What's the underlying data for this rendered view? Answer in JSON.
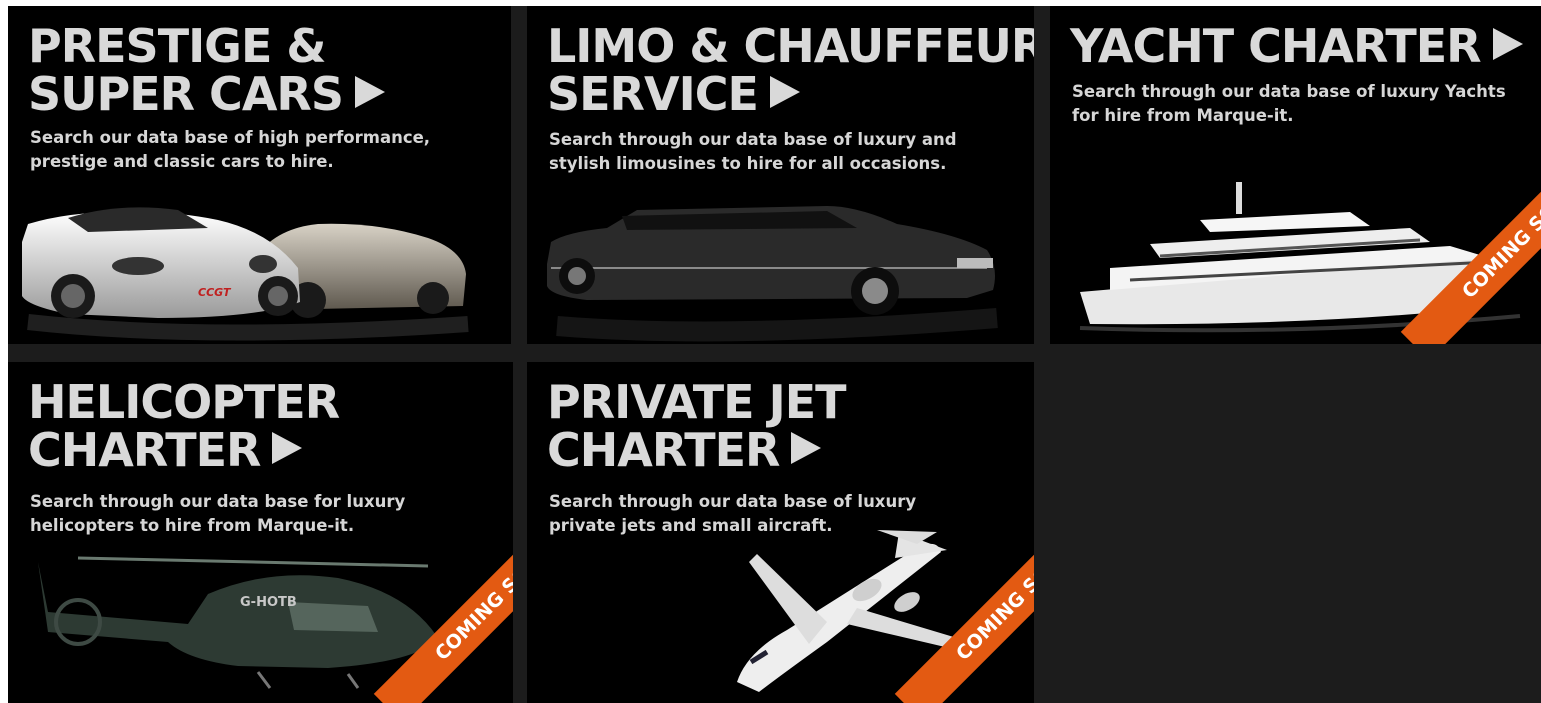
{
  "tiles": [
    {
      "heading": [
        "PRESTIGE &",
        "SUPER CARS"
      ],
      "description": [
        "Search our data base of high performance,",
        "prestige and classic cars to hire."
      ],
      "image": "sports-cars"
    },
    {
      "heading": [
        "LIMO & CHAUFFEUR",
        "SERVICE"
      ],
      "description": [
        "Search through our data base of luxury and",
        "stylish limousines to hire for all occasions."
      ],
      "image": "limousine"
    },
    {
      "heading": [
        "YACHT CHARTER"
      ],
      "description": [
        "Search through our data base of luxury Yachts",
        "for hire from Marque-it."
      ],
      "badge": "COMING SOON",
      "image": "yacht"
    },
    {
      "heading": [
        "HELICOPTER",
        "CHARTER"
      ],
      "description": [
        "Search through our data base for luxury",
        "helicopters to hire from Marque-it."
      ],
      "badge": "COMING SOON",
      "image": "helicopter",
      "registration": "G-HOTB"
    },
    {
      "heading": [
        "PRIVATE JET",
        "CHARTER"
      ],
      "description": [
        "Search through our data base of luxury",
        "private jets and small aircraft."
      ],
      "badge": "COMING SOON",
      "image": "private-jet"
    }
  ],
  "car_badge": "CCGT",
  "colors": {
    "tile_bg": "#000000",
    "frame_bg": "#1c1c1c",
    "text": "#d9d9d9",
    "ribbon": "#e35a12"
  }
}
